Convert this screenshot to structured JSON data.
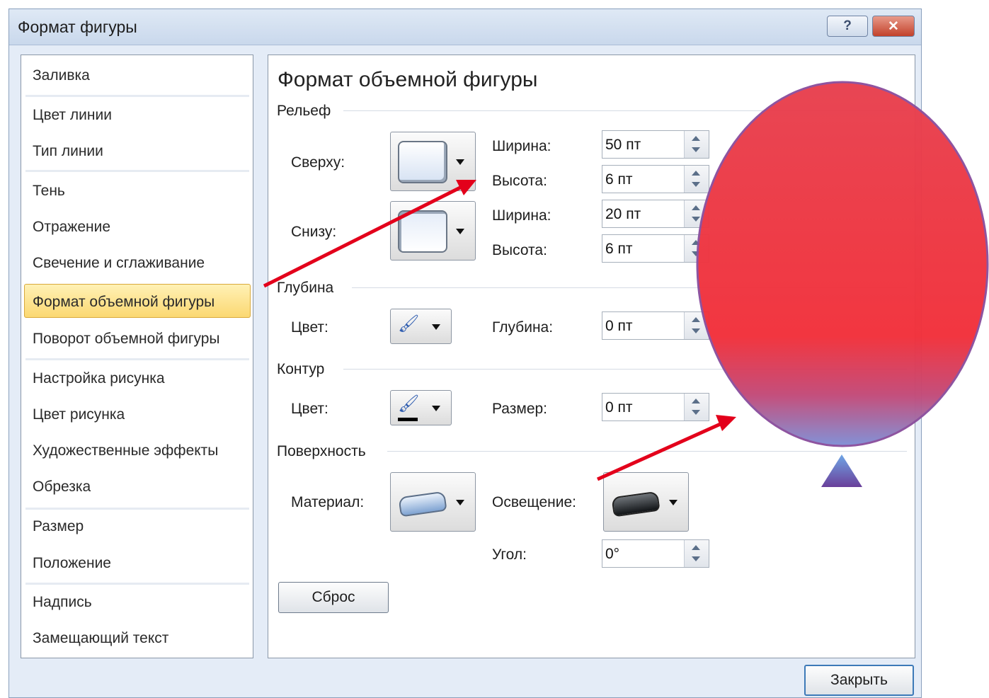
{
  "window": {
    "title": "Формат фигуры",
    "help_label": "?",
    "close_label": "✕"
  },
  "sidebar": {
    "items": [
      {
        "label": "Заливка"
      },
      {
        "label": "Цвет линии"
      },
      {
        "label": "Тип линии"
      },
      {
        "label": "Тень"
      },
      {
        "label": "Отражение"
      },
      {
        "label": "Свечение и сглаживание"
      },
      {
        "label": "Формат объемной фигуры",
        "selected": true
      },
      {
        "label": "Поворот объемной фигуры"
      },
      {
        "label": "Настройка рисунка"
      },
      {
        "label": "Цвет рисунка"
      },
      {
        "label": "Художественные эффекты"
      },
      {
        "label": "Обрезка"
      },
      {
        "label": "Размер"
      },
      {
        "label": "Положение"
      },
      {
        "label": "Надпись"
      },
      {
        "label": "Замещающий текст"
      }
    ]
  },
  "panel": {
    "heading": "Формат объемной фигуры",
    "relief": {
      "section": "Рельеф",
      "top_label": "Сверху:",
      "bottom_label": "Снизу:",
      "width_label": "Ширина:",
      "height_label": "Высота:",
      "top_width": "50 пт",
      "top_height": "6 пт",
      "bottom_width": "20 пт",
      "bottom_height": "6 пт"
    },
    "depth": {
      "section": "Глубина",
      "color_label": "Цвет:",
      "depth_label": "Глубина:",
      "depth_value": "0 пт"
    },
    "contour": {
      "section": "Контур",
      "color_label": "Цвет:",
      "size_label": "Размер:",
      "size_value": "0 пт"
    },
    "surface": {
      "section": "Поверхность",
      "material_label": "Материал:",
      "lighting_label": "Освещение:",
      "angle_label": "Угол:",
      "angle_value": "0°"
    },
    "reset_label": "Сброс"
  },
  "footer": {
    "close_label": "Закрыть"
  },
  "colors": {
    "balloon": "#f2303a",
    "balloon_bottom": "#7f8fd6",
    "arrow": "#e3001b",
    "selection": "#fbd872",
    "dialog_bg": "#e4ecf7"
  }
}
